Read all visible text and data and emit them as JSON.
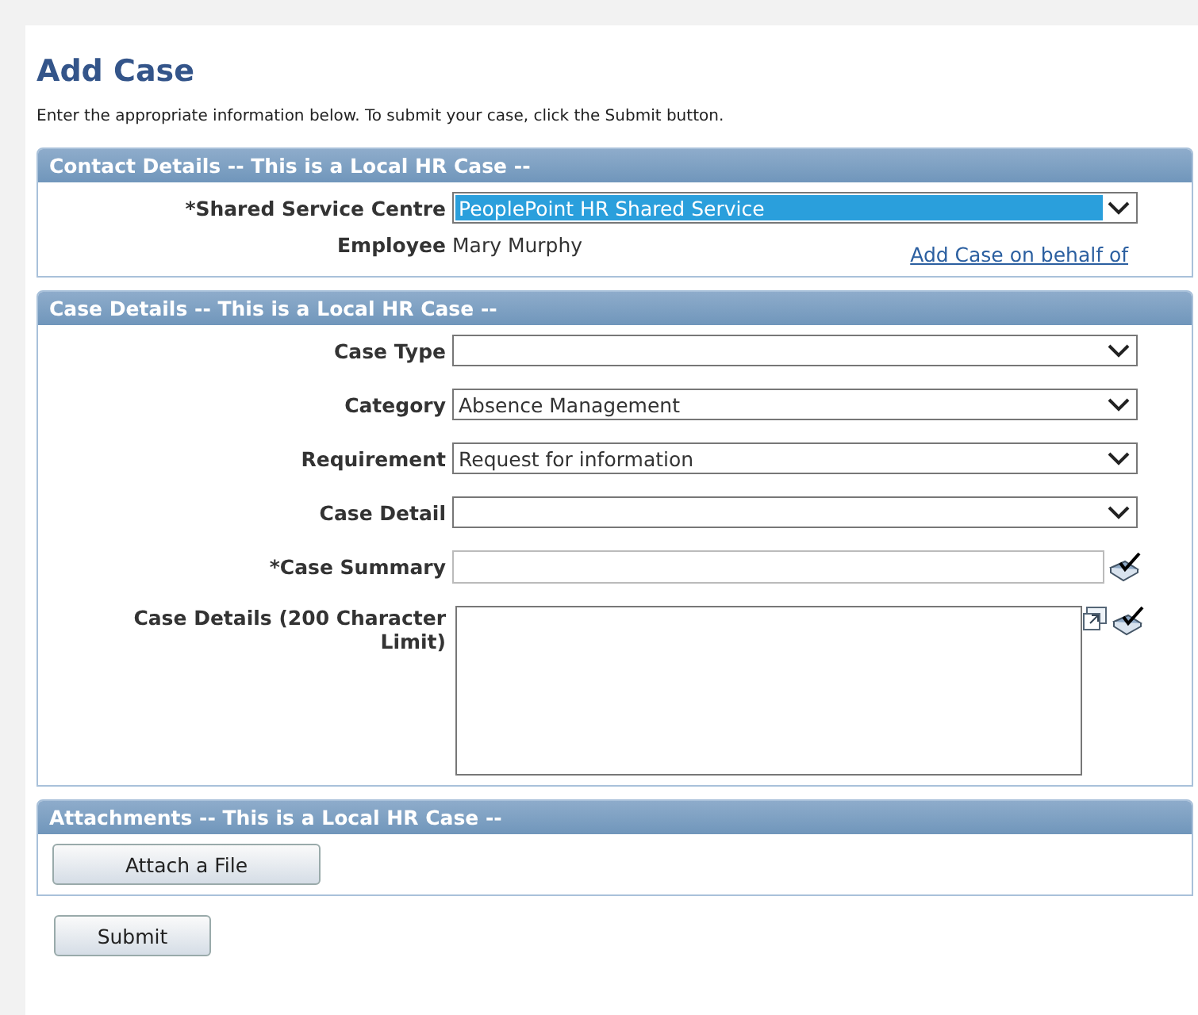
{
  "title": "Add Case",
  "intro": "Enter the appropriate information below. To submit your case, click the Submit button.",
  "contact": {
    "heading": "Contact Details -- This is a Local HR Case --",
    "fields": [
      {
        "kind": "select",
        "label": "*Shared Service Centre",
        "value": "PeoplePoint HR Shared Service",
        "highlighted": true
      },
      {
        "kind": "readonly",
        "label": "Employee",
        "value": "Mary Murphy",
        "link": "Add Case on behalf of"
      }
    ]
  },
  "case": {
    "heading": "Case Details -- This is a Local HR Case --",
    "fields": [
      {
        "kind": "select",
        "label": "Case Type",
        "highlighted": false
      },
      {
        "kind": "select",
        "label": "Category",
        "value": "Absence Management",
        "highlighted": false
      },
      {
        "kind": "select",
        "label": "Requirement",
        "value": "Request for information",
        "highlighted": false
      },
      {
        "kind": "select",
        "label": "Case Detail",
        "highlighted": false
      },
      {
        "kind": "text",
        "label": "*Case Summary"
      },
      {
        "kind": "textarea",
        "label": "Case Details (200 Character Limit)"
      }
    ]
  },
  "attachments": {
    "heading": "Attachments -- This is a Local HR Case --",
    "button": "Attach a File"
  },
  "submit": "Submit"
}
